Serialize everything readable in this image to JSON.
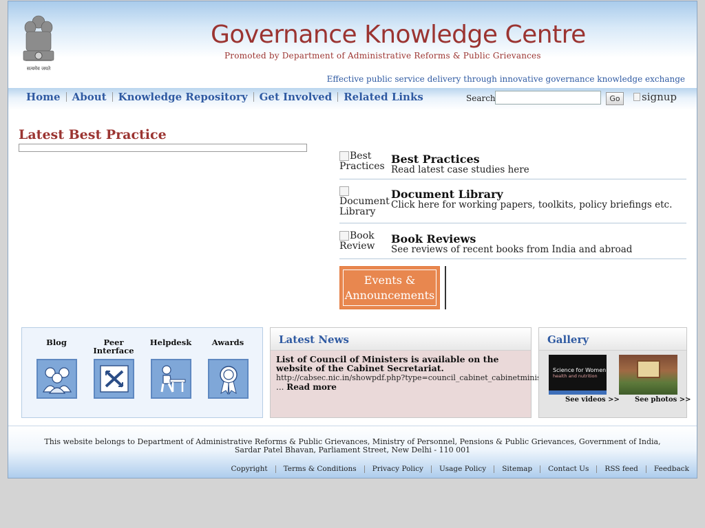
{
  "header": {
    "emblem_caption": "सत्यमेव जयते",
    "title": "Governance Knowledge Centre",
    "subtitle": "Promoted by Department of Administrative Reforms & Public Grievances",
    "tagline": "Effective public service delivery through innovative governance knowledge exchange"
  },
  "nav": {
    "items": [
      "Home",
      "About",
      "Knowledge Repository",
      "Get Involved",
      "Related Links"
    ],
    "search_label": "Search",
    "search_value": "",
    "go_label": "Go",
    "signup_alt": "signup"
  },
  "best_practice": {
    "heading": "Latest Best Practice"
  },
  "quick_links": [
    {
      "img_alt": "Best Practices",
      "title": "Best Practices",
      "desc": "Read latest case studies here"
    },
    {
      "img_alt": "Document Library",
      "title": "Document Library",
      "desc": "Click here for working papers, toolkits, policy briefings etc."
    },
    {
      "img_alt": "Book Review",
      "title": "Book Reviews",
      "desc": "See reviews of recent books from India and abroad"
    }
  ],
  "events": {
    "line1": "Events &",
    "line2": "Announcements"
  },
  "widgets": {
    "blog": "Blog",
    "peer_line1": "Peer",
    "peer_line2": "Interface",
    "helpdesk": "Helpdesk",
    "awards": "Awards"
  },
  "news": {
    "heading": "Latest News",
    "title": "List of Council of Ministers is available on the website of the Cabinet Secretariat.",
    "url": "http://cabsec.nic.in/showpdf.php?type=council_cabinet_cabinetministers",
    "ellipsis": "... ",
    "read_more": "Read more"
  },
  "gallery": {
    "heading": "Gallery",
    "video_line1": "Science for Women",
    "video_line2": "health and nutrition",
    "see_videos": "See videos >>",
    "see_photos": "See photos >>"
  },
  "footer": {
    "line1": "This website belongs to Department of Administrative Reforms & Public Grievances, Ministry of Personnel, Pensions & Public Grievances, Government of India,",
    "line2": "Sardar Patel Bhavan, Parliament Street, New Delhi - 110 001",
    "links": [
      "Copyright",
      "Terms & Conditions",
      "Privacy Policy",
      "Usage Policy",
      "Sitemap",
      "Contact Us",
      "RSS feed",
      "Feedback"
    ]
  },
  "colors": {
    "brand_maroon": "#9b3431",
    "link_blue": "#2f5aa2",
    "events_orange": "#e8874f"
  }
}
